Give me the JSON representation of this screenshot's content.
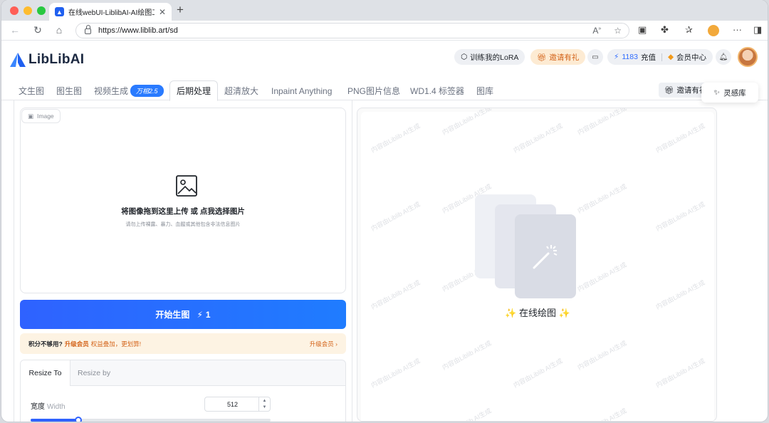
{
  "browser": {
    "tab_title": "在线webUI-LiblibAI-AI绘图工具",
    "url": "https://www.liblib.art/sd"
  },
  "header": {
    "logo_text": "LibLibAI",
    "train_lora": "训练我的LoRA",
    "invite": "邀请有礼",
    "credits": "1183",
    "recharge": "充值",
    "member_center": "会员中心"
  },
  "tabs": [
    {
      "label": "文生图"
    },
    {
      "label": "图生图"
    },
    {
      "label": "视频生成",
      "badge": "万相2.5"
    },
    {
      "label": "后期处理",
      "active": true
    },
    {
      "label": "超清放大"
    },
    {
      "label": "Inpaint Anything"
    },
    {
      "label": "PNG图片信息"
    },
    {
      "label": "WD1.4 标签器"
    },
    {
      "label": "图库"
    }
  ],
  "tab_invite": "邀请有礼",
  "inspiration": "灵感库",
  "upload": {
    "chip": "Image",
    "title": "将图像拖到这里上传 或 点我选择图片",
    "subtitle": "请勿上传裸露、暴力、血腥或其他包含非法信息图片"
  },
  "generate": {
    "label": "开始生图",
    "cost": "1"
  },
  "banner": {
    "text_a": "积分不够用?",
    "text_b": "升级会员",
    "text_c": "权益叠加，更划算!",
    "upgrade": "升级会员 ›"
  },
  "resize": {
    "tab_to": "Resize To",
    "tab_by": "Resize by",
    "width_label": "宽度",
    "width_label_en": "Width",
    "width_value": "512",
    "width_fraction": 0.2
  },
  "preview": {
    "label": "在线绘图",
    "watermark": "内容由Liblib AI生成"
  },
  "colors": {
    "primary": "#2f62ff",
    "accent_orange": "#d4641a"
  }
}
